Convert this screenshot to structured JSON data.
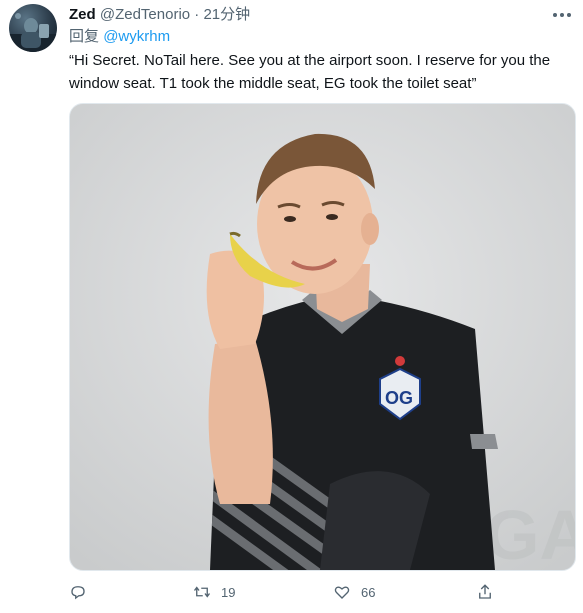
{
  "tweet": {
    "author_name": "Zed",
    "author_handle": "@ZedTenorio",
    "separator": "·",
    "time": "21分钟",
    "reply_prefix": "回复",
    "reply_to": "@wykrhm",
    "text": "“Hi Secret. NoTail here. See you at the airport soon. I reserve for you the window seat. T1 took the middle seat, EG took the toilet seat”"
  },
  "media": {
    "logo_text": "OG"
  },
  "actions": {
    "reply": {
      "icon": "reply-icon"
    },
    "retweet": {
      "icon": "retweet-icon",
      "count": "19"
    },
    "like": {
      "icon": "heart-icon",
      "count": "66"
    },
    "share": {
      "icon": "share-icon"
    }
  },
  "colors": {
    "link": "#1d9bf0",
    "secondary_text": "#536471",
    "primary_text": "#0f1419"
  }
}
